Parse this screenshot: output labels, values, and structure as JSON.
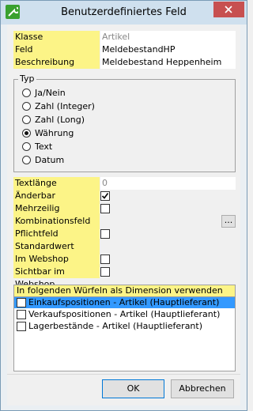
{
  "window": {
    "title": "Benutzerdefiniertes Feld"
  },
  "fields": {
    "klasse": {
      "label": "Klasse",
      "value": "Artikel"
    },
    "feld": {
      "label": "Feld",
      "value": "MeldebestandHP"
    },
    "beschreibung": {
      "label": "Beschreibung",
      "value": "Meldebestand Heppenheim"
    }
  },
  "typ": {
    "legend": "Typ",
    "options": [
      "Ja/Nein",
      "Zahl (Integer)",
      "Zahl (Long)",
      "Währung",
      "Text",
      "Datum"
    ],
    "selected": "Währung"
  },
  "properties": {
    "textlaenge": {
      "label": "Textlänge",
      "value": "0"
    },
    "aenderbar": {
      "label": "Änderbar",
      "checked": true
    },
    "mehrzeilig": {
      "label": "Mehrzeilig",
      "checked": false
    },
    "kombinationsfeld": {
      "label": "Kombinationsfeld",
      "button": "..."
    },
    "pflichtfeld": {
      "label": "Pflichtfeld",
      "checked": false
    },
    "standardwert": {
      "label": "Standardwert"
    },
    "webshop_nutzen": {
      "label": "Im Webshop nutzen",
      "checked": false
    },
    "sichtbar_webshop": {
      "label": "Sichtbar im Webshop",
      "checked": false
    }
  },
  "dimensions": {
    "header": "In folgenden Würfeln als Dimension verwenden",
    "items": [
      {
        "label": "Einkaufspositionen - Artikel (Hauptlieferant)",
        "checked": false,
        "selected": true
      },
      {
        "label": "Verkaufspositionen - Artikel (Hauptlieferant)",
        "checked": false,
        "selected": false
      },
      {
        "label": "Lagerbestände - Artikel (Hauptlieferant)",
        "checked": false,
        "selected": false
      }
    ]
  },
  "buttons": {
    "ok": "OK",
    "cancel": "Abbrechen"
  }
}
